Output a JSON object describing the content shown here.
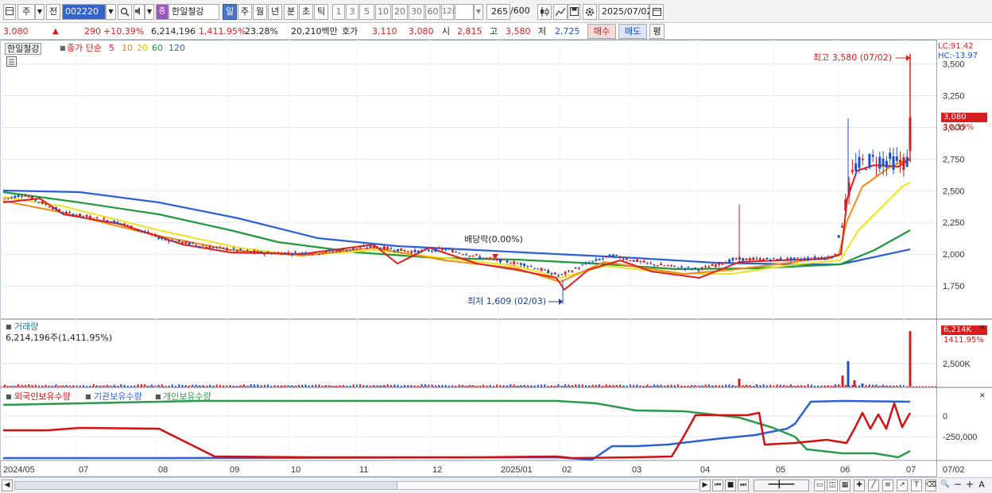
{
  "toolbar": {
    "period_primary": "주",
    "period_prefix": "전",
    "code": "002220",
    "stock_name": "한일철강",
    "stock_icon": "종",
    "periods": [
      "일",
      "주",
      "월",
      "년",
      "분",
      "초",
      "틱"
    ],
    "selected_period": "일",
    "intervals": [
      "1",
      "3",
      "5",
      "10",
      "20",
      "30",
      "60",
      "120"
    ],
    "count": "265",
    "count_max": "/600",
    "date": "2025/07/02"
  },
  "quote": {
    "price": "3,080",
    "change": "290",
    "change_pct": "+10.39%",
    "volume": "6,214,196",
    "volume_pct": "1,411.95%",
    "turnover": "23.28%",
    "amount": "20,210백만",
    "bid_label": "호가",
    "bid": "3,110",
    "ask": "3,080",
    "open_label": "시",
    "open": "2,815",
    "high_label": "고",
    "high": "3,580",
    "low_label": "저",
    "low": "2,725",
    "buy_label": "매수",
    "sell_label": "매도",
    "avg_label": "평"
  },
  "price_panel": {
    "name": "한일철강",
    "indicator": "종가 단순",
    "ma_labels": [
      "5",
      "10",
      "20",
      "60",
      "120"
    ],
    "lc": "LC:91.42",
    "hc": "HC:-13.97",
    "y_ticks": [
      "3,500",
      "3,250",
      "3,000",
      "2,750",
      "2,500",
      "2,250",
      "2,000",
      "1,750"
    ],
    "last_tag": "3,080",
    "last_pct": "10.39%",
    "high_note": "최고 3,580 (07/02)",
    "low_note": "최저 1,609 (02/03)",
    "dividend_note": "배당락(0.00%)"
  },
  "volume_panel": {
    "title": "거래량",
    "value": "6,214,196주(1,411.95%)",
    "tag": "6,214K",
    "tag_pct": "1411.95%",
    "y_ticks": [
      "2,500K"
    ]
  },
  "holdings_panel": {
    "legend": [
      "외국인보유수량",
      "기관보유수량",
      "개인보유수량"
    ],
    "y_ticks": [
      "0",
      "-250,000"
    ]
  },
  "x_axis": [
    "2024/05",
    "07",
    "08",
    "09",
    "10",
    "11",
    "12",
    "2025/01",
    "02",
    "03",
    "04",
    "05",
    "06",
    "07",
    "07/02"
  ],
  "colors": {
    "up": "#d71e1e",
    "down": "#1b52c8",
    "ma5": "#e02020",
    "ma10": "#f08c14",
    "ma20": "#f2e023",
    "ma60": "#1f9a3a",
    "ma120": "#2c5fd8",
    "foreign": "#d40f0f",
    "institution": "#2c5fd8",
    "individual": "#2a9a4a"
  }
}
